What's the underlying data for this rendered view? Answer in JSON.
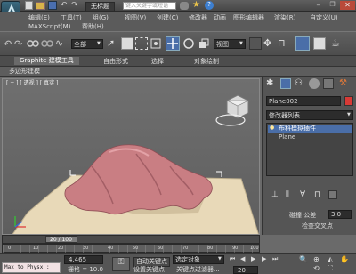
{
  "app": {
    "doc_title": "无标题",
    "search_placeholder": "键入关键字或短语"
  },
  "menu": {
    "row1": [
      "编辑(E)",
      "工具(T)",
      "组(G)",
      "视图(V)",
      "创建(C)",
      "修改器",
      "动画",
      "图形编辑器",
      "渲染(R)",
      "自定义(U)"
    ],
    "row2": [
      "MAXScript(M)",
      "帮助(H)"
    ]
  },
  "toolbar": {
    "selection_filter": "全部",
    "ref_coord": "视图"
  },
  "ribbon": {
    "tabs": [
      "Graphite 建模工具",
      "自由形式",
      "选择",
      "对象绘制"
    ],
    "sub_label": "多边形建模"
  },
  "viewport": {
    "label": "[ + ] [ 透视 ] [ 真实 ]"
  },
  "cmd_panel": {
    "object_name": "Plane002",
    "modifier_list": "修改器列表",
    "stack": [
      {
        "label": "布料模拟插件",
        "selected": true
      },
      {
        "label": "Plane",
        "selected": false
      }
    ],
    "rollout": {
      "chamfer_label": "碰撞 公差",
      "chamfer_value": "3.0",
      "check_label": "检查交叉点"
    }
  },
  "timeline": {
    "frame_display": "20 / 100",
    "ticks": [
      "0",
      "10",
      "20",
      "30",
      "40",
      "50",
      "60",
      "70",
      "80",
      "90",
      "100"
    ]
  },
  "status": {
    "script_text": "Max to Physx :",
    "coord_value": "4.465",
    "grid_label": "栅格 = 10.0",
    "autokey_label": "自动关键点",
    "setkey_label": "设置关键点",
    "selected_label": "选定对象",
    "filter_label": "关键点过滤器...",
    "frame_field": "20"
  },
  "colors": {
    "cloth": "#c97e83",
    "plane": "#e8d9b8",
    "selection": "#4a6ea8"
  }
}
